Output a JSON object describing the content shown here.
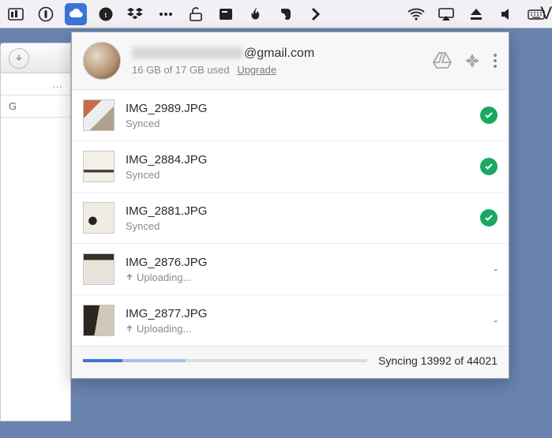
{
  "menubar": {
    "truncated_letter": "V"
  },
  "background": {
    "row_label": "G"
  },
  "header": {
    "email_blurred": true,
    "email_suffix": "@gmail.com",
    "storage": "16 GB of 17 GB used",
    "upgrade_label": "Upgrade"
  },
  "files": [
    {
      "name": "IMG_2989.JPG",
      "status": "Synced",
      "state": "synced"
    },
    {
      "name": "IMG_2884.JPG",
      "status": "Synced",
      "state": "synced"
    },
    {
      "name": "IMG_2881.JPG",
      "status": "Synced",
      "state": "synced"
    },
    {
      "name": "IMG_2876.JPG",
      "status": "Uploading...",
      "state": "uploading"
    },
    {
      "name": "IMG_2877.JPG",
      "status": "Uploading...",
      "state": "uploading"
    }
  ],
  "footer": {
    "sync_text": "Syncing 13992 of 44021",
    "progress_dark_pct": 14,
    "progress_mid_pct": 22
  }
}
